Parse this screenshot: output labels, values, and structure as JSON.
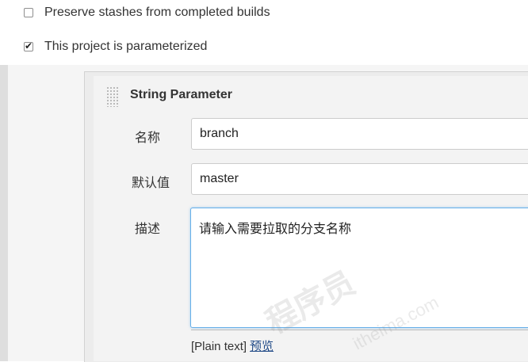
{
  "options": {
    "preserve_stashes": {
      "label": "Preserve stashes from completed builds",
      "checked": false
    },
    "parameterized": {
      "label": "This project is parameterized",
      "checked": true
    }
  },
  "parameter": {
    "title": "String Parameter",
    "name_label": "名称",
    "name_value": "branch",
    "default_label": "默认值",
    "default_value": "master",
    "description_label": "描述",
    "description_value": "请输入需要拉取的分支名称"
  },
  "hint": {
    "plain_text": "[Plain text]",
    "preview_link": "预览"
  },
  "watermark": {
    "main": "程序员",
    "sub": "itheima.com"
  },
  "colors": {
    "focus_border": "#66afe9",
    "link": "#204a87"
  }
}
